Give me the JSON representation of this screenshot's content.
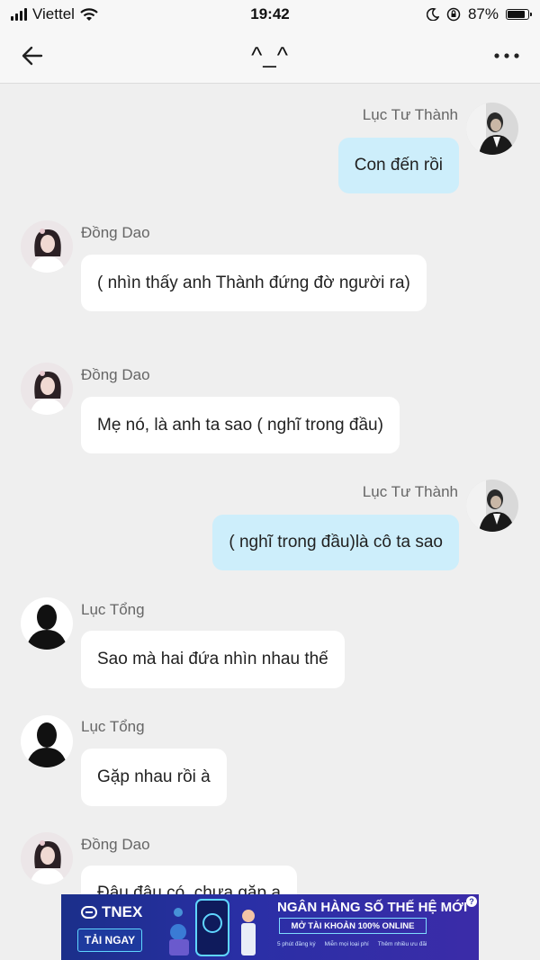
{
  "status_bar": {
    "carrier": "Viettel",
    "time": "19:42",
    "battery_percent": "87%",
    "battery_level": 0.87,
    "icons": [
      "signal-icon",
      "wifi-icon",
      "moon-icon",
      "orientation-lock-icon",
      "battery-icon"
    ]
  },
  "header": {
    "title": "^_^",
    "back_icon": "arrow-left-icon",
    "more_icon": "more-dots-icon"
  },
  "messages": [
    {
      "sender": "Lục Tư Thành",
      "text": "Con đến rồi",
      "mine": true
    },
    {
      "sender": "Đồng Dao",
      "text": "( nhìn thấy anh Thành đứng đờ người ra)",
      "mine": false
    },
    {
      "sender": "Đồng Dao",
      "text": "Mẹ nó, là anh ta sao ( nghĩ trong đầu)",
      "mine": false
    },
    {
      "sender": "Lục Tư Thành",
      "text": "( nghĩ trong đầu)là cô ta sao",
      "mine": true
    },
    {
      "sender": "Lục Tổng",
      "text": "Sao mà hai đứa nhìn nhau thế",
      "mine": false
    },
    {
      "sender": "Lục Tổng",
      "text": "Gặp nhau rồi à",
      "mine": false
    },
    {
      "sender": "Đồng Dao",
      "text": "Đâu đâu có, chưa gặp a",
      "mine": false
    }
  ],
  "ad": {
    "brand": "TNEX",
    "cta": "TẢI NGAY",
    "headline": "NGÂN HÀNG SỐ THẾ HỆ MỚI",
    "subheadline": "MỞ TÀI KHOẢN 100% ONLINE",
    "features": [
      "5 phút đăng ký",
      "Miễn mọi loại phí",
      "Thêm nhiều ưu đãi"
    ],
    "help": "?"
  }
}
